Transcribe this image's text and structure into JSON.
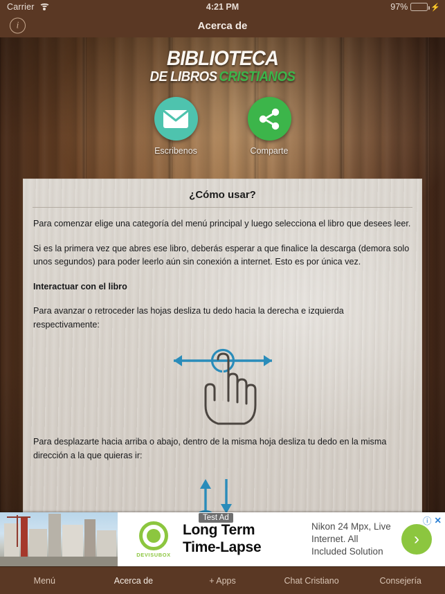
{
  "status_bar": {
    "carrier": "Carrier",
    "wifi_icon": "wifi-icon",
    "time": "4:21 PM",
    "battery_percent": "97%",
    "battery_level": 97,
    "charging_icon": "lightning-bolt-icon"
  },
  "nav_bar": {
    "title": "Acerca de",
    "info_icon": "info-circle-icon",
    "info_glyph": "i"
  },
  "header": {
    "logo_line1": "BIBLIOTECA",
    "logo_line2_white": "DE LIBROS",
    "logo_line2_green": "CRISTIANOS",
    "green_color": "#3cb54a"
  },
  "actions": [
    {
      "icon": "envelope-icon",
      "label": "Escribenos",
      "color": "#4ec3ae"
    },
    {
      "icon": "share-icon",
      "label": "Comparte",
      "color": "#3cb54a"
    }
  ],
  "card": {
    "title": "¿Cómo usar?",
    "paragraphs": [
      "Para comenzar elige una categoría del menú principal y luego selecciona el libro que desees leer.",
      "Si es la primera vez que abres ese libro, deberás esperar a que finalice la descarga (demora solo unos segundos) para poder leerlo aún sin conexión a internet. Esto es por única vez.",
      "Interactuar con el libro",
      "Para avanzar o retroceder las hojas desliza tu dedo hacia la derecha e izquierda respectivamente:",
      "Para desplazarte hacia arriba o abajo, dentro de la misma hoja desliza tu dedo en la misma dirección a la que quieras ir:"
    ],
    "gesture1_icon": "swipe-horizontal-hand-icon",
    "gesture2_icon": "swipe-vertical-hand-icon",
    "gesture_accent_color": "#2a8cba"
  },
  "ad": {
    "badge": "Test Ad",
    "headline_line1": "Long Term",
    "headline_line2": "Time-Lapse",
    "description": "Nikon 24 Mpx, Live Internet. All Included Solution",
    "brand": "DEVISUBOX",
    "brand_color": "#8cc63f",
    "image_alt": "construction-site-photo",
    "cta_icon": "chevron-right-icon",
    "info_icon": "ad-info-icon",
    "close_icon": "ad-close-icon"
  },
  "tab_bar": {
    "items": [
      {
        "label": "Menú",
        "active": false
      },
      {
        "label": "Acerca de",
        "active": true
      },
      {
        "label": "+ Apps",
        "active": false
      },
      {
        "label": "Chat Cristiano",
        "active": false
      },
      {
        "label": "Consejería",
        "active": false
      }
    ]
  }
}
